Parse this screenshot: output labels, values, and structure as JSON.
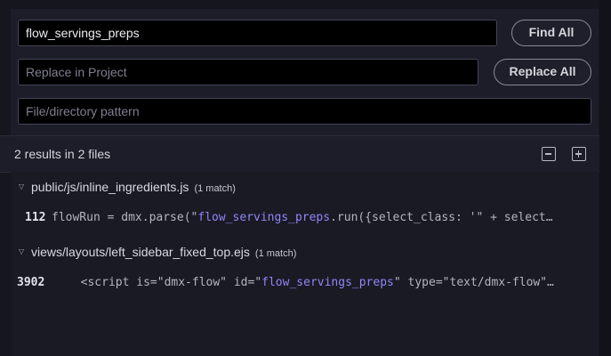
{
  "find": {
    "query": "flow_servings_preps",
    "find_all_label": "Find All"
  },
  "replace": {
    "placeholder": "Replace in Project",
    "replace_all_label": "Replace All"
  },
  "pattern": {
    "placeholder": "File/directory pattern"
  },
  "summary": {
    "text": "2 results in 2 files",
    "collapse_icon": "collapse-all-icon",
    "expand_icon": "expand-all-icon"
  },
  "results": [
    {
      "path": "public/js/inline_ingredients.js",
      "match_count": "(1 match)",
      "line_number": "112",
      "before": "flowRun = dmx.parse(\"",
      "match": "flow_servings_preps",
      "after": ".run({select_class: '\" + select…"
    },
    {
      "path": "views/layouts/left_sidebar_fixed_top.ejs",
      "match_count": "(1 match)",
      "line_number": "3902",
      "before": "  <script is=\"dmx-flow\" id=\"",
      "match": "flow_servings_preps",
      "after": "\" type=\"text/dmx-flow\"…"
    }
  ],
  "colors": {
    "background": "#16161f",
    "field_background": "#000000",
    "match_highlight": "#8f86f5"
  }
}
